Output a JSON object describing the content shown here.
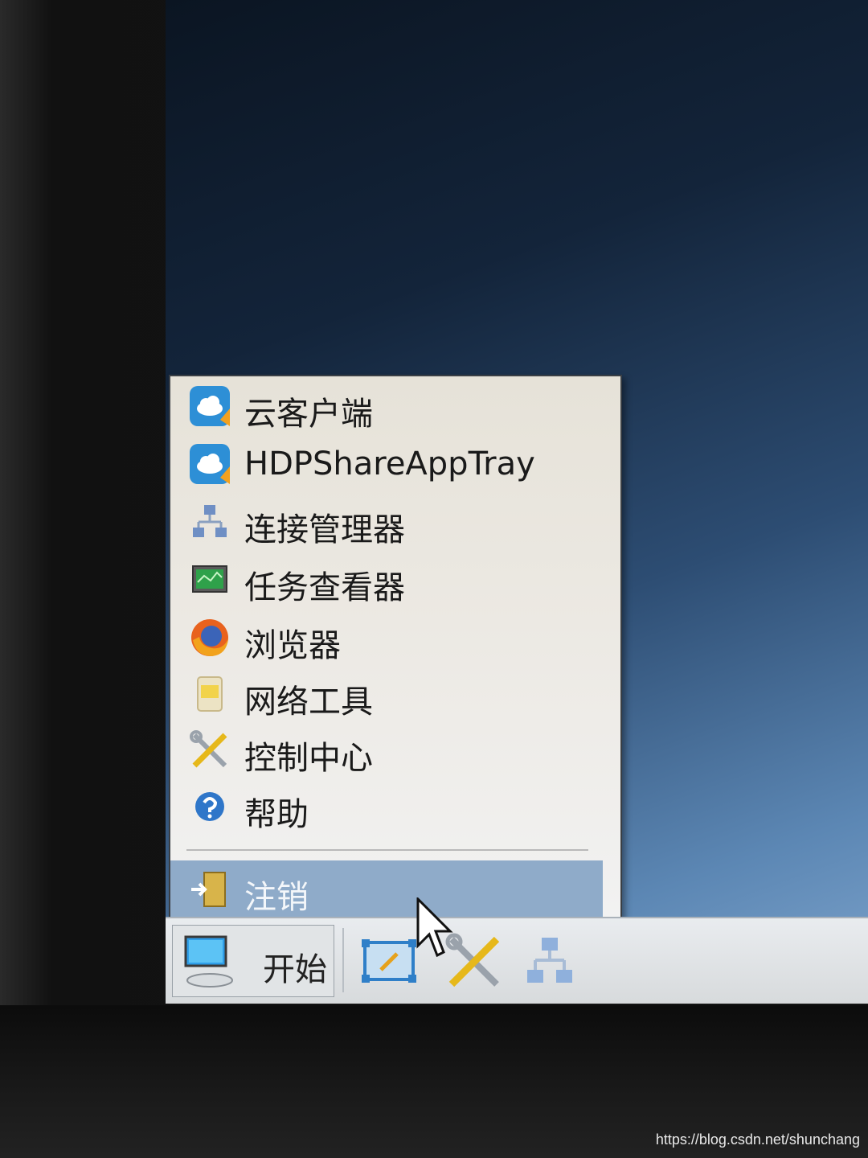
{
  "start_menu": {
    "items": [
      {
        "label": "云客户端",
        "icon": "cloud-client-icon"
      },
      {
        "label": "HDPShareAppTray",
        "icon": "cloud-share-icon"
      },
      {
        "label": "连接管理器",
        "icon": "network-connections-icon"
      },
      {
        "label": "任务查看器",
        "icon": "task-monitor-icon"
      },
      {
        "label": "浏览器",
        "icon": "firefox-browser-icon"
      },
      {
        "label": "网络工具",
        "icon": "network-tools-icon"
      },
      {
        "label": "控制中心",
        "icon": "tools-wrench-screwdriver-icon"
      },
      {
        "label": "帮助",
        "icon": "help-icon"
      }
    ],
    "logout": {
      "label": "注销",
      "icon": "logout-door-icon",
      "highlighted": true
    }
  },
  "taskbar": {
    "start_label": "开始",
    "quick_launch": [
      "screen-capture-icon",
      "tools-wrench-screwdriver-icon",
      "network-connections-icon"
    ]
  },
  "watermark": "https://blog.csdn.net/shunchang",
  "colors": {
    "menu_highlight": "#8fabc9",
    "desktop_top": "#0b1522",
    "desktop_bottom": "#7ea4cc",
    "taskbar": "#e1e4e6"
  }
}
